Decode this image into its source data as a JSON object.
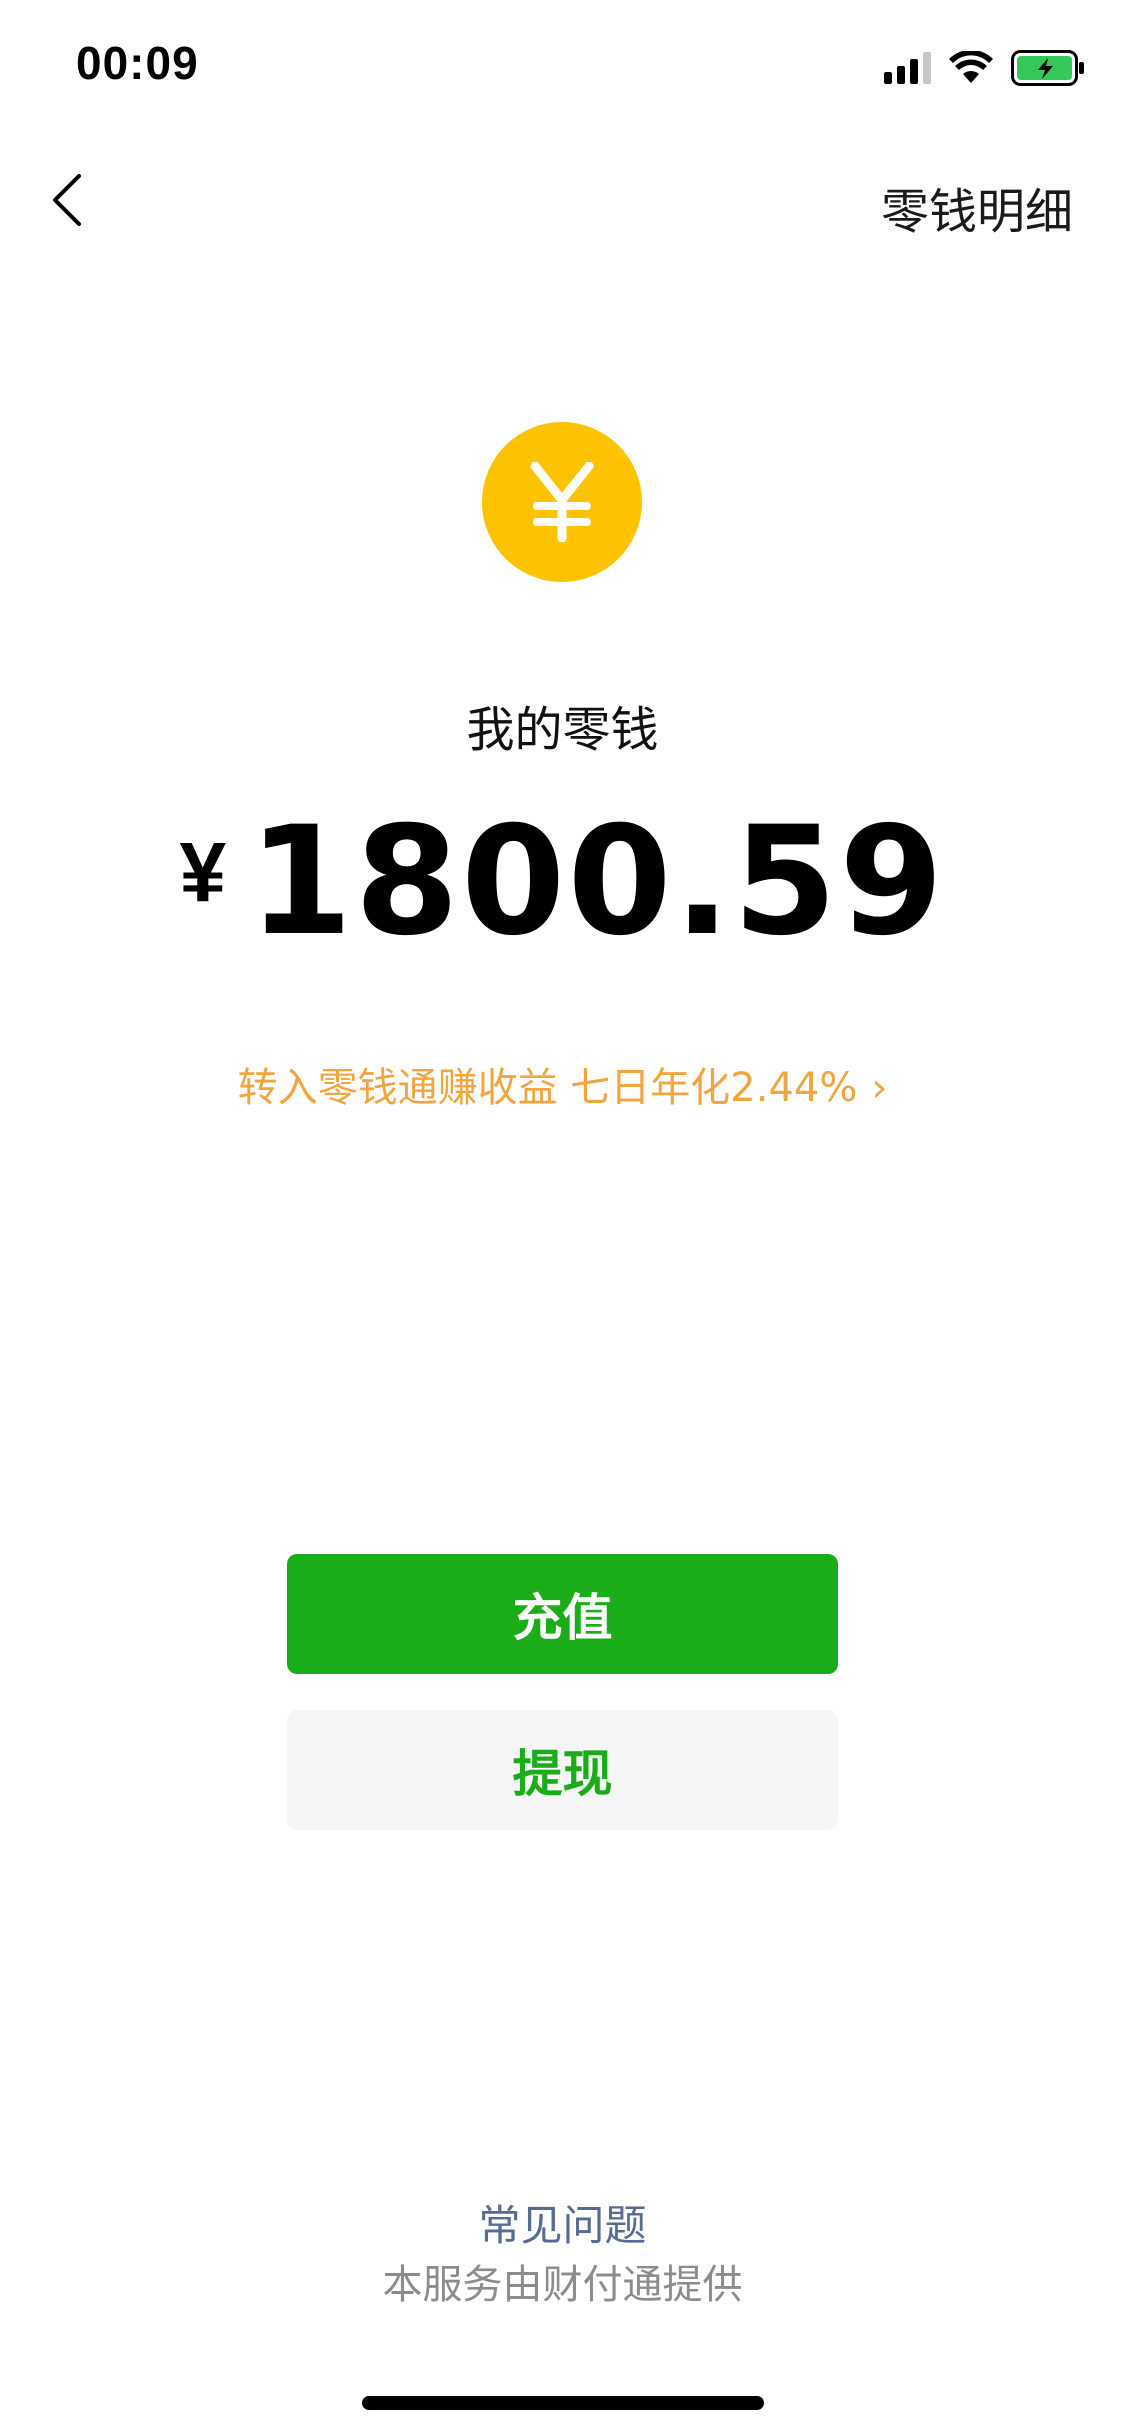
{
  "status_bar": {
    "time": "00:09",
    "icons": [
      "signal-icon",
      "wifi-icon",
      "battery-charging-icon"
    ]
  },
  "nav": {
    "back_icon": "chevron-left-icon",
    "detail_label": "零钱明细"
  },
  "wallet": {
    "icon": "yuan-coin-icon",
    "coin_symbol": "¥",
    "title": "我的零钱",
    "currency_symbol": "¥",
    "balance": "1800.59",
    "promo_text": "转入零钱通赚收益 七日年化2.44%",
    "promo_chevron": "›"
  },
  "actions": {
    "recharge_label": "充值",
    "withdraw_label": "提现"
  },
  "footer": {
    "faq_label": "常见问题",
    "provider_note": "本服务由财付通提供"
  },
  "colors": {
    "primary_green": "#1aad19",
    "coin_yellow": "#fdc300",
    "promo_orange": "#f1a540",
    "link_blue": "#576b95",
    "muted_gray": "#8c8c8c",
    "secondary_button_bg": "#f6f6f6"
  }
}
